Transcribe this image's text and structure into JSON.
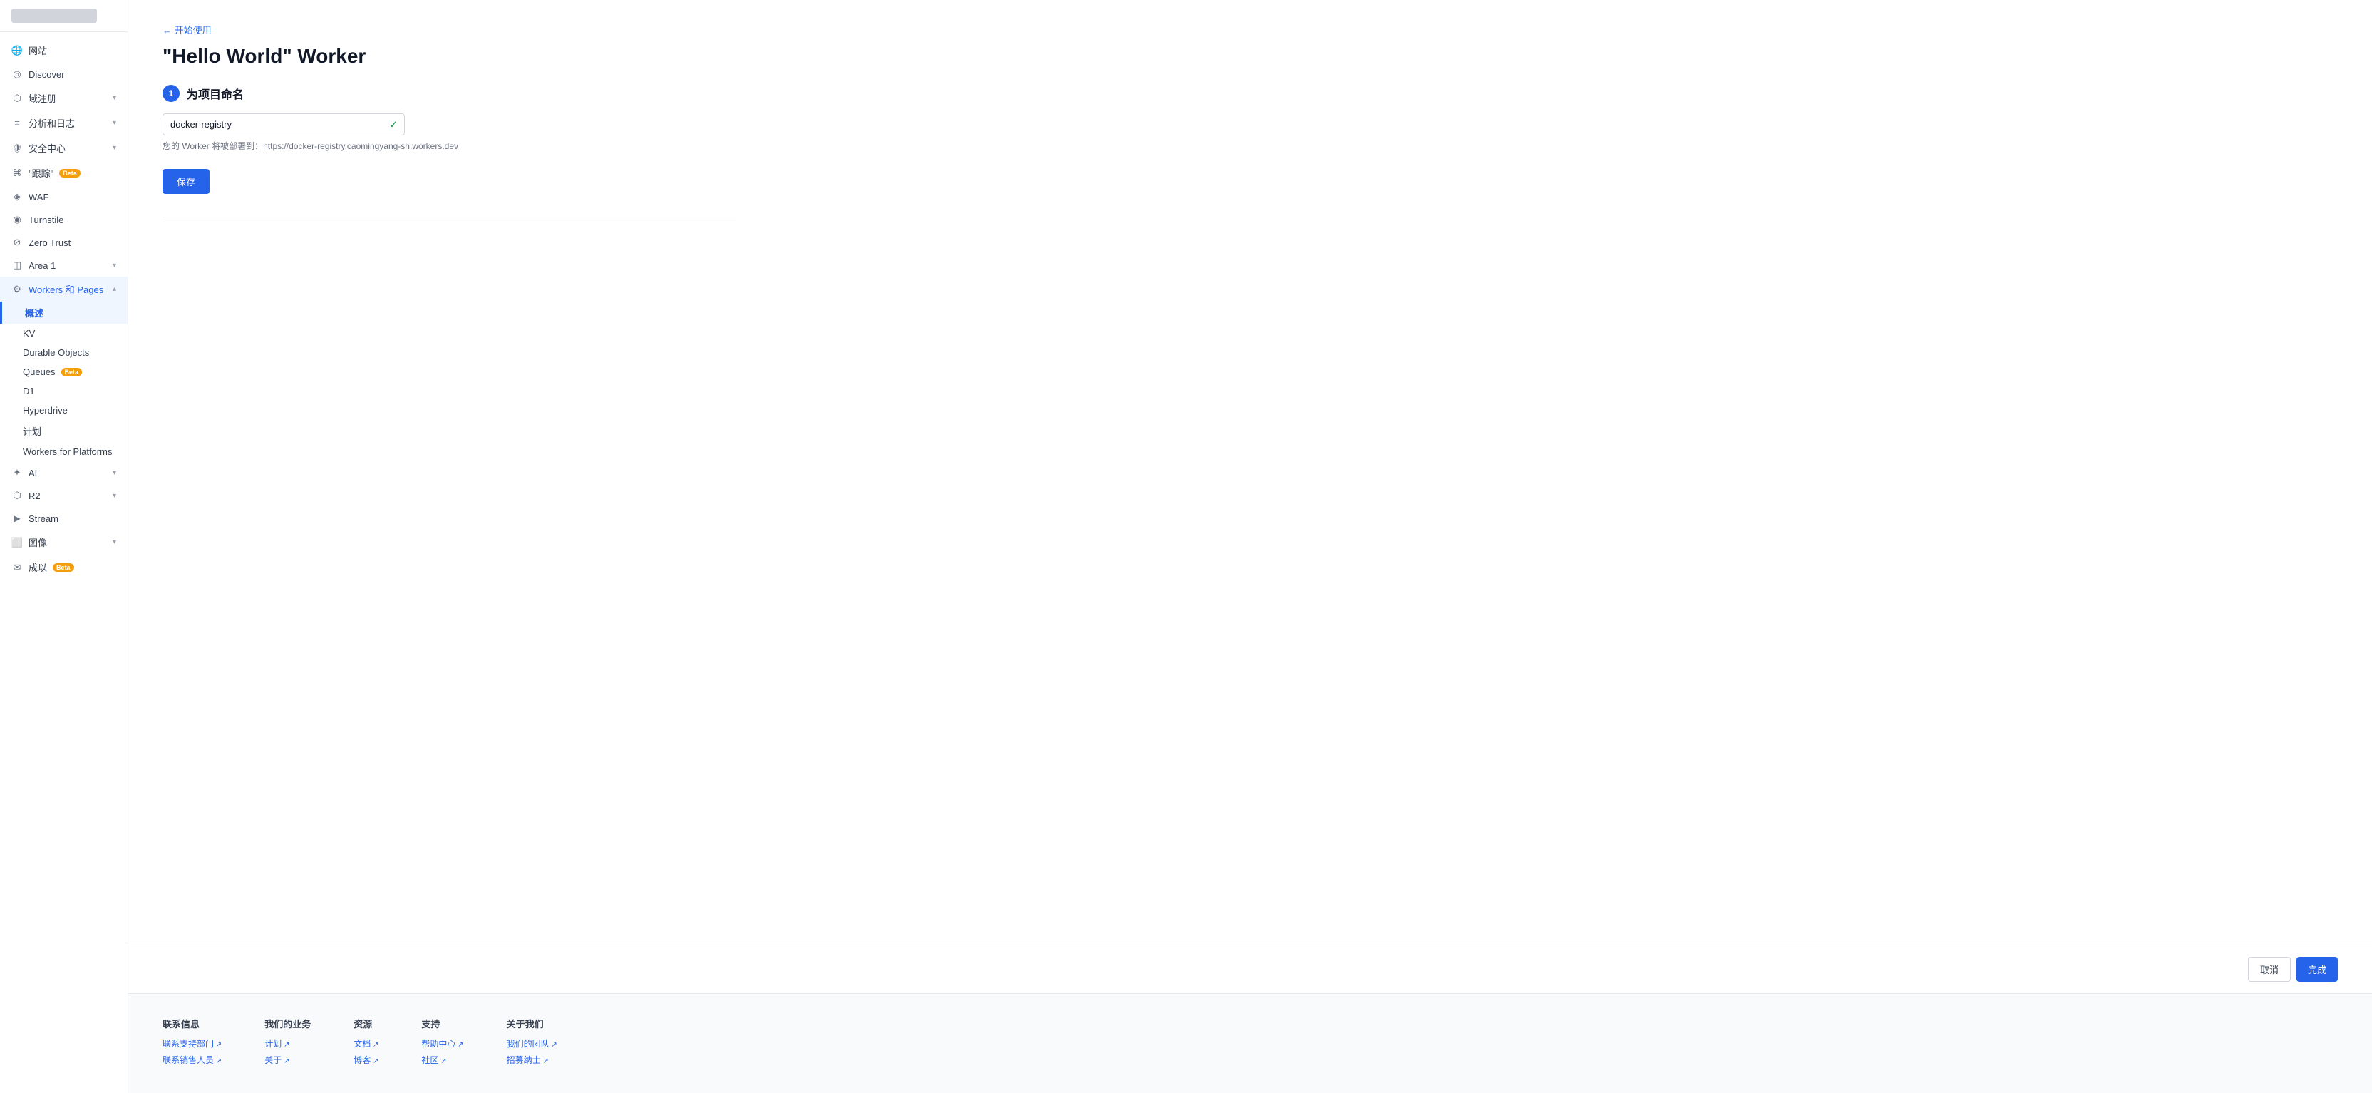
{
  "sidebar": {
    "logo_placeholder": "logo",
    "items": [
      {
        "id": "website",
        "label": "网站",
        "icon": "globe",
        "hasChevron": false,
        "active": false
      },
      {
        "id": "discover",
        "label": "Discover",
        "icon": "discover",
        "hasChevron": false,
        "active": false
      },
      {
        "id": "domain",
        "label": "域注册",
        "icon": "domain",
        "hasChevron": true,
        "active": false
      },
      {
        "id": "analytics",
        "label": "分析和日志",
        "icon": "analytics",
        "hasChevron": true,
        "active": false
      },
      {
        "id": "security",
        "label": "安全中心",
        "icon": "security",
        "hasChevron": true,
        "active": false
      },
      {
        "id": "trace",
        "label": "\"跟踪\"",
        "icon": "trace",
        "hasChevron": false,
        "badge": "Beta",
        "active": false
      },
      {
        "id": "waf",
        "label": "WAF",
        "icon": "waf",
        "hasChevron": false,
        "active": false
      },
      {
        "id": "turnstile",
        "label": "Turnstile",
        "icon": "turnstile",
        "hasChevron": false,
        "active": false
      },
      {
        "id": "zerotrust",
        "label": "Zero Trust",
        "icon": "zerotrust",
        "hasChevron": false,
        "active": false
      },
      {
        "id": "area1",
        "label": "Area 1",
        "icon": "area",
        "hasChevron": true,
        "active": false
      },
      {
        "id": "workers",
        "label": "Workers 和 Pages",
        "icon": "workers",
        "hasChevron": true,
        "active": true
      },
      {
        "id": "ai",
        "label": "AI",
        "icon": "ai",
        "hasChevron": true,
        "active": false
      },
      {
        "id": "r2",
        "label": "R2",
        "icon": "r2",
        "hasChevron": true,
        "active": false
      },
      {
        "id": "stream",
        "label": "Stream",
        "icon": "stream",
        "hasChevron": false,
        "active": false
      },
      {
        "id": "images",
        "label": "图像",
        "icon": "images",
        "hasChevron": true,
        "active": false
      },
      {
        "id": "email",
        "label": "成以",
        "icon": "email",
        "hasChevron": false,
        "badge": "Beta",
        "active": false
      }
    ],
    "sub_items": [
      {
        "id": "overview",
        "label": "概述",
        "active": true
      },
      {
        "id": "kv",
        "label": "KV",
        "active": false
      },
      {
        "id": "durable-objects",
        "label": "Durable Objects",
        "active": false
      },
      {
        "id": "queues",
        "label": "Queues",
        "badge": "Beta",
        "active": false
      },
      {
        "id": "d1",
        "label": "D1",
        "active": false
      },
      {
        "id": "hyperdrive",
        "label": "Hyperdrive",
        "active": false
      },
      {
        "id": "plan",
        "label": "计划",
        "active": false
      },
      {
        "id": "workers-platforms",
        "label": "Workers for Platforms",
        "active": false
      }
    ]
  },
  "breadcrumb": {
    "back_label": "← 开始使用",
    "back_href": "#"
  },
  "page": {
    "title": "\"Hello World\" Worker",
    "step1": {
      "number": "1",
      "title": "为项目命名",
      "input_value": "docker-registry",
      "hint": "您的 Worker 将被部署到：https://docker-registry.caomingyang-sh.workers.dev",
      "save_label": "保存"
    }
  },
  "actions": {
    "cancel_label": "取消",
    "complete_label": "完成"
  },
  "footer": {
    "cols": [
      {
        "title": "联系信息",
        "links": [
          "联系支持部门",
          "联系销售人员"
        ]
      },
      {
        "title": "我们的业务",
        "links": [
          "计划",
          "关于"
        ]
      },
      {
        "title": "资源",
        "links": [
          "文档",
          "博客"
        ]
      },
      {
        "title": "支持",
        "links": [
          "帮助中心",
          "社区"
        ]
      },
      {
        "title": "关于我们",
        "links": [
          "我们的团队",
          "招募纳士"
        ]
      }
    ]
  }
}
